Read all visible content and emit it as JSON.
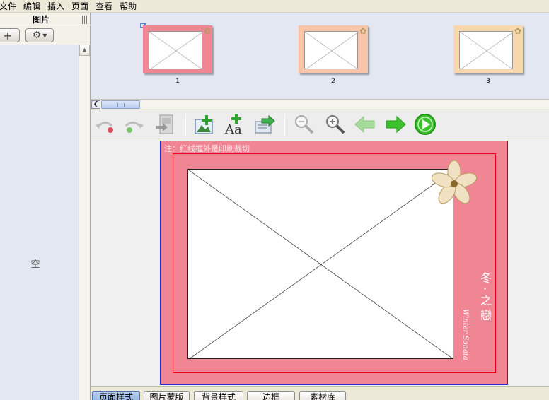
{
  "menu": [
    "文件",
    "编辑",
    "插入",
    "页面",
    "查看",
    "帮助"
  ],
  "left_panel": {
    "title": "图片",
    "add_button": "+",
    "gear_icon": "gear-icon",
    "empty_text": "空"
  },
  "thumbnails": [
    {
      "number": "1",
      "bg": "#f08593",
      "selected": true
    },
    {
      "number": "2",
      "bg": "#f9c5aa",
      "selected": false
    },
    {
      "number": "3",
      "bg": "#f7d7ae",
      "selected": false
    }
  ],
  "toolbar": {
    "icons": [
      "undo-icon",
      "redo-icon",
      "delete-page-icon",
      "add-image-icon",
      "add-text-icon",
      "import-icon",
      "zoom-out-icon",
      "zoom-in-icon",
      "prev-page-icon",
      "next-page-icon",
      "play-icon"
    ]
  },
  "page": {
    "note": "注：红线框外是印刷裁切",
    "deco_text": "冬 · 之 戀",
    "deco_english": "Winter Sonata"
  },
  "bottom_tabs": [
    "页面样式",
    "图片蒙版",
    "背景样式",
    "边框",
    "素材库"
  ],
  "colors": {
    "page_bg": "#f08593",
    "trim_line": "#e60012",
    "page_border": "#2a2ad2",
    "selection": "#5b87c9"
  }
}
